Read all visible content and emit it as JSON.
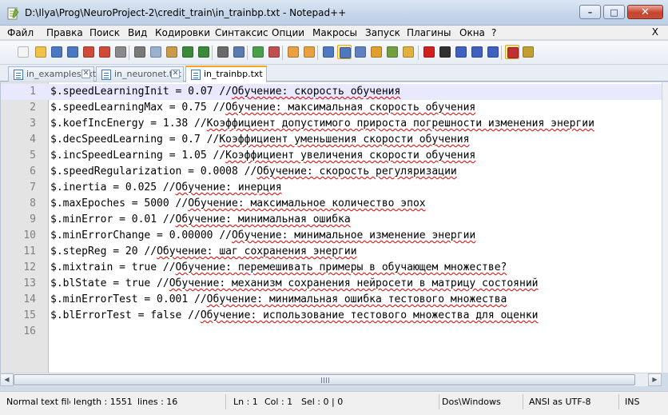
{
  "window": {
    "title": "D:\\Ilya\\Prog\\NeuroProject-2\\credit_train\\in_trainbp.txt - Notepad++",
    "minimize_glyph": "–",
    "maximize_glyph": "□",
    "close_glyph": "✕"
  },
  "menu": {
    "items": [
      "Файл",
      "Правка",
      "Поиск",
      "Вид",
      "Кодировки",
      "Синтаксис",
      "Опции",
      "Макросы",
      "Запуск",
      "Плагины",
      "Окна",
      "?"
    ],
    "close_label": "X"
  },
  "toolbar": {
    "buttons": [
      "new-file-icon",
      "open-file-icon",
      "save-icon",
      "save-all-icon",
      "close-icon",
      "close-all-icon",
      "print-icon",
      "cut-icon",
      "copy-icon",
      "paste-icon",
      "undo-icon",
      "redo-icon",
      "find-icon",
      "replace-icon",
      "zoom-in-icon",
      "zoom-out-icon",
      "sync-vertical-icon",
      "sync-horizontal-icon",
      "word-wrap-icon",
      "show-all-chars-icon",
      "indent-guide-icon",
      "document-map-icon",
      "function-list-icon",
      "folder-as-workspace-icon",
      "record-macro-icon",
      "stop-record-icon",
      "play-macro-icon",
      "run-macro-multiple-icon",
      "save-macro-icon",
      "spellcheck-icon",
      "settings-icon"
    ]
  },
  "tabs": [
    {
      "label": "in_examples.txt",
      "active": false
    },
    {
      "label": "in_neuronet.txt",
      "active": false
    },
    {
      "label": "in_trainbp.txt",
      "active": true
    }
  ],
  "editor": {
    "current_line": 1,
    "lines": [
      {
        "num": "1",
        "code": "$.speedLearningInit = 0.07 //",
        "comment": "Обучение: скорость обучения"
      },
      {
        "num": "2",
        "code": "$.speedLearningMax = 0.75 //",
        "comment": "Обучение: максимальная скорость обучения"
      },
      {
        "num": "3",
        "code": "$.koefIncEnergy = 1.38 //",
        "comment": "Коэффициент допустимого прироста погрешности изменения энергии"
      },
      {
        "num": "4",
        "code": "$.decSpeedLearning = 0.7 //",
        "comment": "Коэффициент уменьшения скорости обучения"
      },
      {
        "num": "5",
        "code": "$.incSpeedLearning = 1.05 //",
        "comment": "Коэффициент увеличения скорости обучения"
      },
      {
        "num": "6",
        "code": "$.speedRegularization = 0.0008 //",
        "comment": "Обучение: скорость регуляризации"
      },
      {
        "num": "7",
        "code": "$.inertia = 0.025 //",
        "comment": "Обучение: инерция"
      },
      {
        "num": "8",
        "code": "$.maxEpoches = 5000 //",
        "comment": "Обучение: максимальное количество эпох"
      },
      {
        "num": "9",
        "code": "$.minError = 0.01 //",
        "comment": "Обучение: минимальная ошибка"
      },
      {
        "num": "10",
        "code": "$.minErrorChange = 0.00000 //",
        "comment": "Обучение: минимальное изменение энергии"
      },
      {
        "num": "11",
        "code": "$.stepReg = 20 //",
        "comment": "Обучение: шаг сохранения энергии"
      },
      {
        "num": "12",
        "code": "$.mixtrain = true //",
        "comment": "Обучение: перемешивать примеры в обучающем множестве?"
      },
      {
        "num": "13",
        "code": "$.blState = true //",
        "comment": "Обучение: механизм сохранения нейросети в матрицу состояний"
      },
      {
        "num": "14",
        "code": "$.minErrorTest = 0.001 //",
        "comment": "Обучение: минимальная ошибка тестового множества"
      },
      {
        "num": "15",
        "code": "$.blErrorTest = false //",
        "comment": "Обучение: использование тестового множества для оценки"
      },
      {
        "num": "16",
        "code": "",
        "comment": ""
      }
    ]
  },
  "statusbar": {
    "file_type": "Normal text file",
    "length": "length : 1551",
    "lines": "lines : 16",
    "ln": "Ln : 1",
    "col": "Col : 1",
    "sel": "Sel : 0 | 0",
    "eol": "Dos\\Windows",
    "encoding": "ANSI as UTF-8",
    "mode": "INS"
  }
}
